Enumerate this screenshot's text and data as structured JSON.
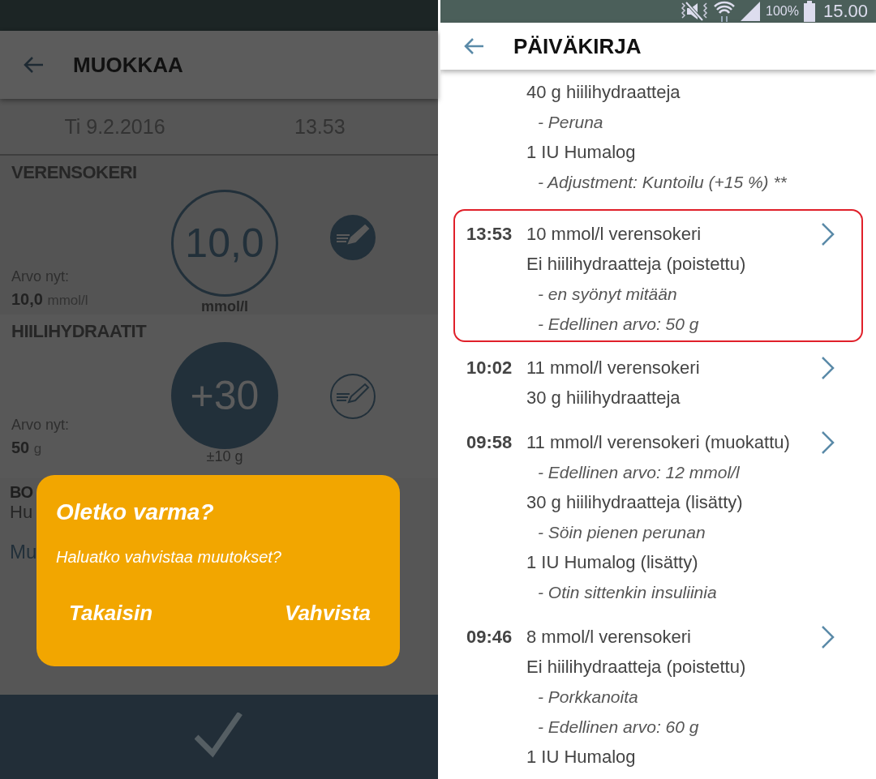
{
  "edit_screen": {
    "app_bar": {
      "title": "MUOKKAA"
    },
    "date": "Ti 9.2.2016",
    "time": "13.53",
    "sections": [
      {
        "title": "VERENSOKERI",
        "current_label": "Arvo nyt:",
        "current_value": "10,0",
        "current_unit": "mmol/l",
        "dial_value": "10,0",
        "dial_unit": "mmol/l",
        "kind": "outlined"
      },
      {
        "title": "HIILIHYDRAATIT",
        "current_label": "Arvo nyt:",
        "current_value": "50",
        "current_unit": "g",
        "dial_value": "+30",
        "dial_unit": "±10 g",
        "kind": "filled"
      }
    ],
    "hidden_texts": [
      "BO",
      "Hu",
      "Mu"
    ],
    "dialog": {
      "title": "Oletko varma?",
      "message": "Haluatko vahvistaa muutokset?",
      "buttons": [
        "Takaisin",
        "Vahvista"
      ]
    }
  },
  "diary_screen": {
    "status_bar": {
      "battery": "100%",
      "time": "15.00"
    },
    "app_bar": {
      "title": "PÄIVÄKIRJA"
    },
    "entries": [
      {
        "highlighted": false,
        "arrow": false,
        "lines": [
          {
            "kind": "main",
            "text": "40 g hiilihydraatteja"
          },
          {
            "kind": "note",
            "text": "- Peruna"
          },
          {
            "kind": "main",
            "text": "1 IU Humalog"
          },
          {
            "kind": "note",
            "text": "- Adjustment: Kuntoilu (+15 %) **"
          }
        ]
      },
      {
        "time": "13:53",
        "highlighted": true,
        "arrow": true,
        "lines": [
          {
            "kind": "main",
            "text": "10 mmol/l verensokeri"
          },
          {
            "kind": "main",
            "text": "Ei hiilihydraatteja (poistettu)"
          },
          {
            "kind": "note",
            "text": "- en syönyt mitään"
          },
          {
            "kind": "note",
            "text": "- Edellinen arvo: 50 g"
          }
        ]
      },
      {
        "time": "10:02",
        "highlighted": false,
        "arrow": true,
        "lines": [
          {
            "kind": "main",
            "text": "11 mmol/l verensokeri"
          },
          {
            "kind": "main",
            "text": "30 g hiilihydraatteja"
          }
        ]
      },
      {
        "time": "09:58",
        "highlighted": false,
        "arrow": true,
        "lines": [
          {
            "kind": "main",
            "text": "11 mmol/l verensokeri (muokattu)"
          },
          {
            "kind": "note",
            "text": "- Edellinen arvo: 12 mmol/l"
          },
          {
            "kind": "main",
            "text": "30 g hiilihydraatteja (lisätty)"
          },
          {
            "kind": "note",
            "text": "- Söin pienen perunan"
          },
          {
            "kind": "main",
            "text": "1 IU Humalog (lisätty)"
          },
          {
            "kind": "note",
            "text": "- Otin sittenkin insuliinia"
          }
        ]
      },
      {
        "time": "09:46",
        "highlighted": false,
        "arrow": true,
        "lines": [
          {
            "kind": "main",
            "text": "8 mmol/l verensokeri"
          },
          {
            "kind": "main",
            "text": "Ei hiilihydraatteja (poistettu)"
          },
          {
            "kind": "note",
            "text": "- Porkkanoita"
          },
          {
            "kind": "note",
            "text": "- Edellinen arvo: 60 g"
          },
          {
            "kind": "main",
            "text": "1 IU Humalog"
          }
        ]
      }
    ]
  }
}
